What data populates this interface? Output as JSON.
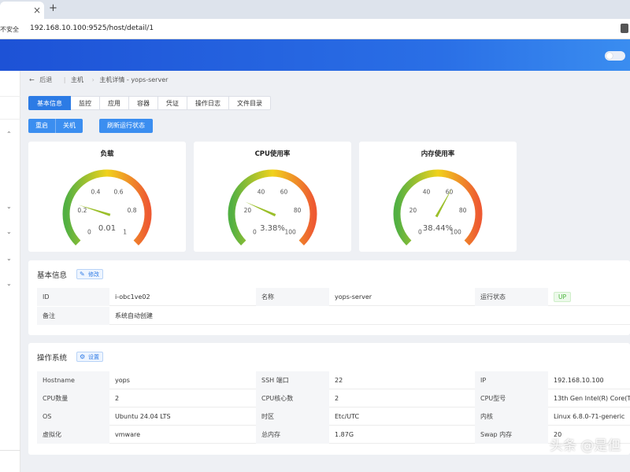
{
  "browser": {
    "tab_close": "×",
    "tab_new": "+",
    "insecure_label": "不安全",
    "url": "192.168.10.100:9525/host/detail/1"
  },
  "breadcrumb": {
    "back": "后退",
    "item1": "主机",
    "item2": "主机详情 - yops-server"
  },
  "tabs": [
    "基本信息",
    "监控",
    "应用",
    "容器",
    "凭证",
    "操作日志",
    "文件目录"
  ],
  "actions": {
    "restart": "重启",
    "shutdown": "关机",
    "refresh": "刷新运行状态"
  },
  "gauges": [
    {
      "title": "负载",
      "min": 0,
      "max": 1,
      "value": 0.01,
      "value_label": "0.01",
      "ticks": [
        "0",
        "0.2",
        "0.4",
        "0.6",
        "0.8",
        "1"
      ]
    },
    {
      "title": "CPU使用率",
      "min": 0,
      "max": 100,
      "value": 3.38,
      "value_label": "3.38%",
      "ticks": [
        "0",
        "20",
        "40",
        "60",
        "80",
        "100"
      ]
    },
    {
      "title": "内存使用率",
      "min": 0,
      "max": 100,
      "value": 38.44,
      "value_label": "38.44%",
      "ticks": [
        "0",
        "20",
        "40",
        "60",
        "80",
        "100"
      ]
    }
  ],
  "basic": {
    "title": "基本信息",
    "edit_label": "修改",
    "rows": [
      [
        {
          "label": "ID",
          "value": "i-obc1ve02"
        },
        {
          "label": "名称",
          "value": "yops-server"
        },
        {
          "label": "运行状态",
          "value": "UP"
        }
      ],
      [
        {
          "label": "备注",
          "value": "系统自动创建"
        }
      ]
    ]
  },
  "os": {
    "title": "操作系统",
    "settings_label": "设置",
    "rows": [
      [
        {
          "label": "Hostname",
          "value": "yops"
        },
        {
          "label": "SSH 端口",
          "value": "22"
        },
        {
          "label": "IP",
          "value": "192.168.10.100"
        }
      ],
      [
        {
          "label": "CPU数量",
          "value": "2"
        },
        {
          "label": "CPU核心数",
          "value": "2"
        },
        {
          "label": "CPU型号",
          "value": "13th Gen Intel(R) Core(TM"
        }
      ],
      [
        {
          "label": "OS",
          "value": "Ubuntu 24.04 LTS"
        },
        {
          "label": "时区",
          "value": "Etc/UTC"
        },
        {
          "label": "内核",
          "value": "Linux 6.8.0-71-generic"
        }
      ],
      [
        {
          "label": "虚拟化",
          "value": "vmware"
        },
        {
          "label": "总内存",
          "value": "1.87G"
        },
        {
          "label": "Swap 内存",
          "value": "20"
        }
      ]
    ]
  },
  "colors": {
    "primary": "#2c7be5",
    "header_start": "#1d52d6",
    "header_end": "#3a8df0",
    "gauge_green": "#52b043",
    "gauge_yellow": "#f0d21c",
    "gauge_red": "#ee5a32"
  },
  "watermark": "头条 @是但"
}
